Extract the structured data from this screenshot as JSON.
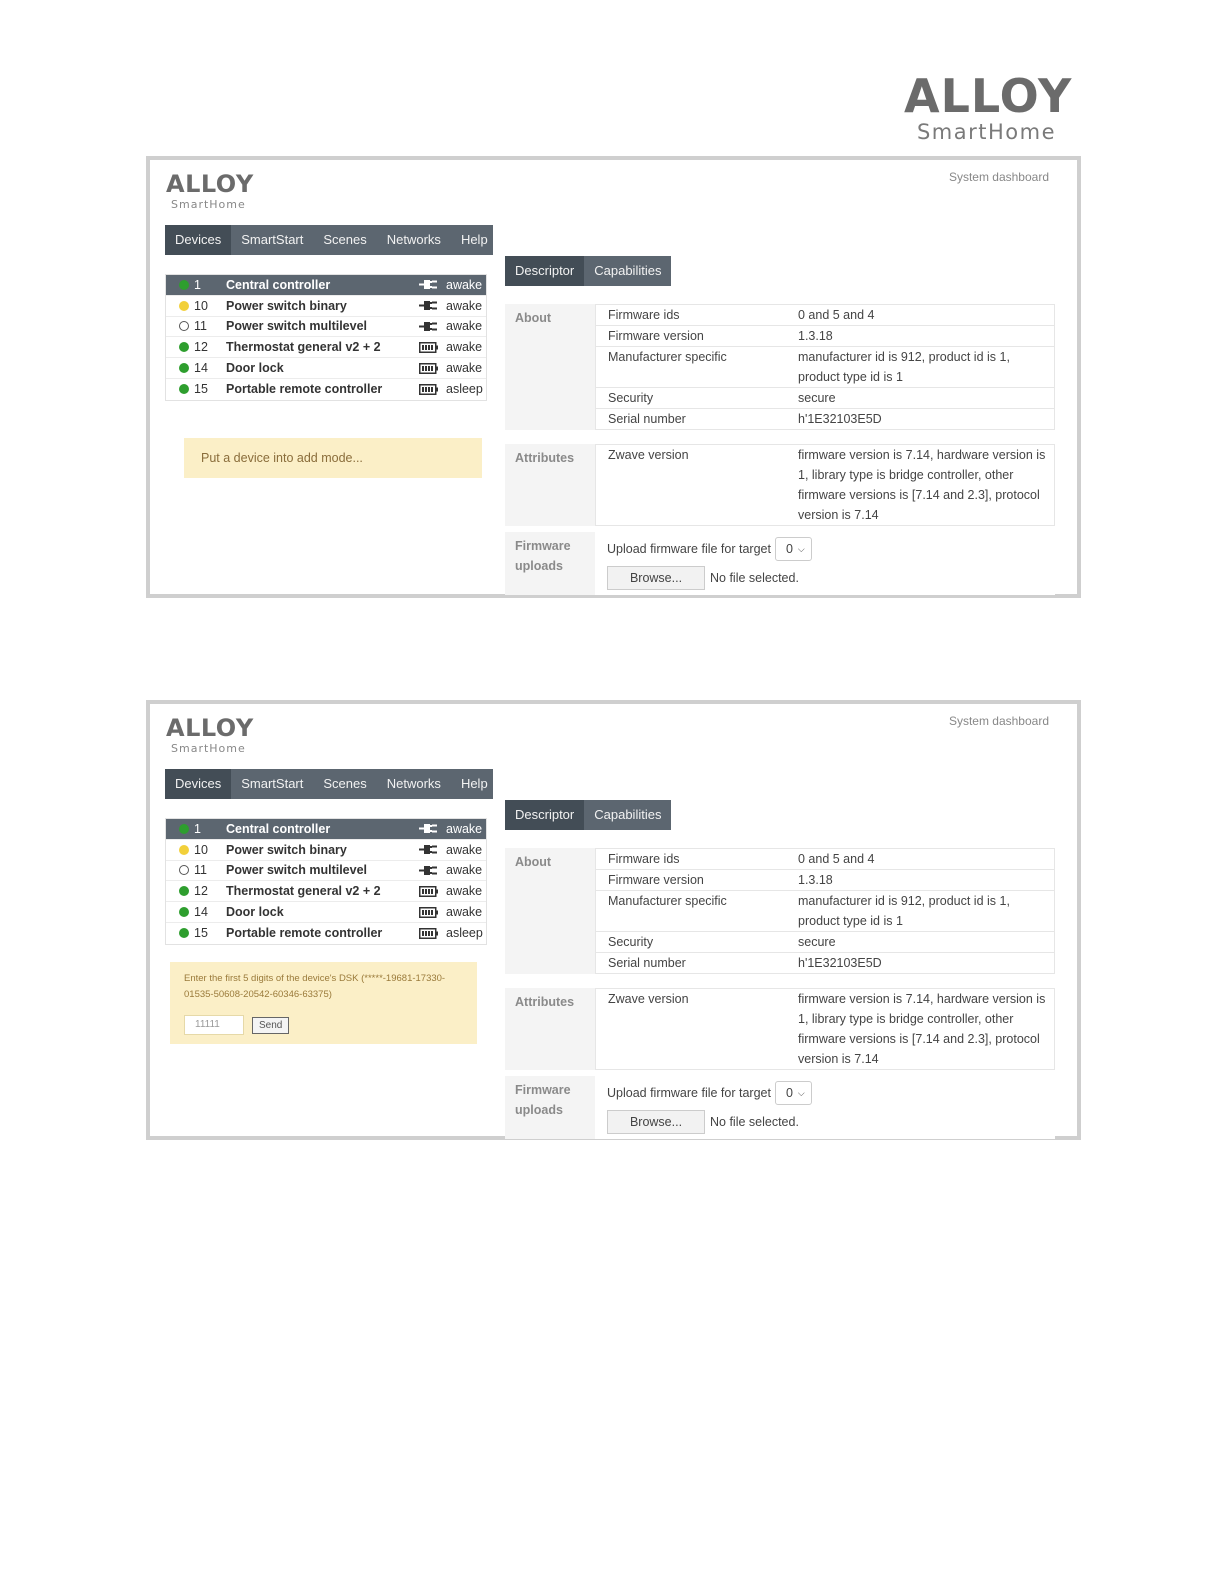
{
  "page_logo": {
    "brand": "ALLOY",
    "sub": "SmartHome"
  },
  "panels": [
    {
      "logo": {
        "brand": "ALLOY",
        "sub": "SmartHome"
      },
      "system_dashboard": "System dashboard",
      "nav": [
        "Devices",
        "SmartStart",
        "Scenes",
        "Networks",
        "Help"
      ],
      "devices": [
        {
          "id": "1",
          "name": "Central controller",
          "state": "awake",
          "status": "green",
          "icon": "plug-icon"
        },
        {
          "id": "10",
          "name": "Power switch binary",
          "state": "awake",
          "status": "yellow",
          "icon": "plug-icon"
        },
        {
          "id": "11",
          "name": "Power switch multilevel",
          "state": "awake",
          "status": "empty",
          "icon": "plug-icon"
        },
        {
          "id": "12",
          "name": "Thermostat general v2 + 2",
          "state": "awake",
          "status": "green",
          "icon": "battery-icon"
        },
        {
          "id": "14",
          "name": "Door lock",
          "state": "awake",
          "status": "green",
          "icon": "battery-icon"
        },
        {
          "id": "15",
          "name": "Portable remote controller",
          "state": "asleep",
          "status": "green",
          "icon": "battery-icon"
        }
      ],
      "notice": "Put a device into add mode...",
      "tabs": [
        "Descriptor",
        "Capabilities"
      ],
      "about_label": "About",
      "about": [
        {
          "k": "Firmware ids",
          "v": "0 and 5 and 4"
        },
        {
          "k": "Firmware version",
          "v": "1.3.18"
        },
        {
          "k": "Manufacturer specific",
          "v": "manufacturer id is 912, product id is 1, product type id is 1"
        },
        {
          "k": "Security",
          "v": "secure"
        },
        {
          "k": "Serial number",
          "v": "h'1E32103E5D"
        }
      ],
      "attributes_label": "Attributes",
      "attributes": [
        {
          "k": "Zwave version",
          "v": "firmware version is 7.14, hardware version is 1, library type is bridge controller, other firmware versions is [7.14 and 2.3], protocol version is 7.14"
        }
      ],
      "firmware_label": "Firmware uploads",
      "upload_text": "Upload firmware file for target",
      "target_value": "0",
      "browse_label": "Browse...",
      "no_file": "No file selected."
    },
    {
      "logo": {
        "brand": "ALLOY",
        "sub": "SmartHome"
      },
      "system_dashboard": "System dashboard",
      "nav": [
        "Devices",
        "SmartStart",
        "Scenes",
        "Networks",
        "Help"
      ],
      "devices": [
        {
          "id": "1",
          "name": "Central controller",
          "state": "awake",
          "status": "green",
          "icon": "plug-icon"
        },
        {
          "id": "10",
          "name": "Power switch binary",
          "state": "awake",
          "status": "yellow",
          "icon": "plug-icon"
        },
        {
          "id": "11",
          "name": "Power switch multilevel",
          "state": "awake",
          "status": "empty",
          "icon": "plug-icon"
        },
        {
          "id": "12",
          "name": "Thermostat general v2 + 2",
          "state": "awake",
          "status": "green",
          "icon": "battery-icon"
        },
        {
          "id": "14",
          "name": "Door lock",
          "state": "awake",
          "status": "green",
          "icon": "battery-icon"
        },
        {
          "id": "15",
          "name": "Portable remote controller",
          "state": "asleep",
          "status": "green",
          "icon": "battery-icon"
        }
      ],
      "dsk_prompt": "Enter the first 5 digits of the device's DSK (*****-19681-17330-01535-50608-20542-60346-63375)",
      "dsk_value": "11111",
      "send_label": "Send",
      "tabs": [
        "Descriptor",
        "Capabilities"
      ],
      "about_label": "About",
      "about": [
        {
          "k": "Firmware ids",
          "v": "0 and 5 and 4"
        },
        {
          "k": "Firmware version",
          "v": "1.3.18"
        },
        {
          "k": "Manufacturer specific",
          "v": "manufacturer id is 912, product id is 1, product type id is 1"
        },
        {
          "k": "Security",
          "v": "secure"
        },
        {
          "k": "Serial number",
          "v": "h'1E32103E5D"
        }
      ],
      "attributes_label": "Attributes",
      "attributes": [
        {
          "k": "Zwave version",
          "v": "firmware version is 7.14, hardware version is 1, library type is bridge controller, other firmware versions is [7.14 and 2.3], protocol version is 7.14"
        }
      ],
      "firmware_label": "Firmware uploads",
      "upload_text": "Upload firmware file for target",
      "target_value": "0",
      "browse_label": "Browse...",
      "no_file": "No file selected."
    }
  ],
  "colors": {
    "nav_bg": "#5c6670",
    "nav_active": "#434d56",
    "notice_bg": "#fbefc7",
    "status_green": "#2e9e2e",
    "status_yellow": "#f2d03a"
  }
}
